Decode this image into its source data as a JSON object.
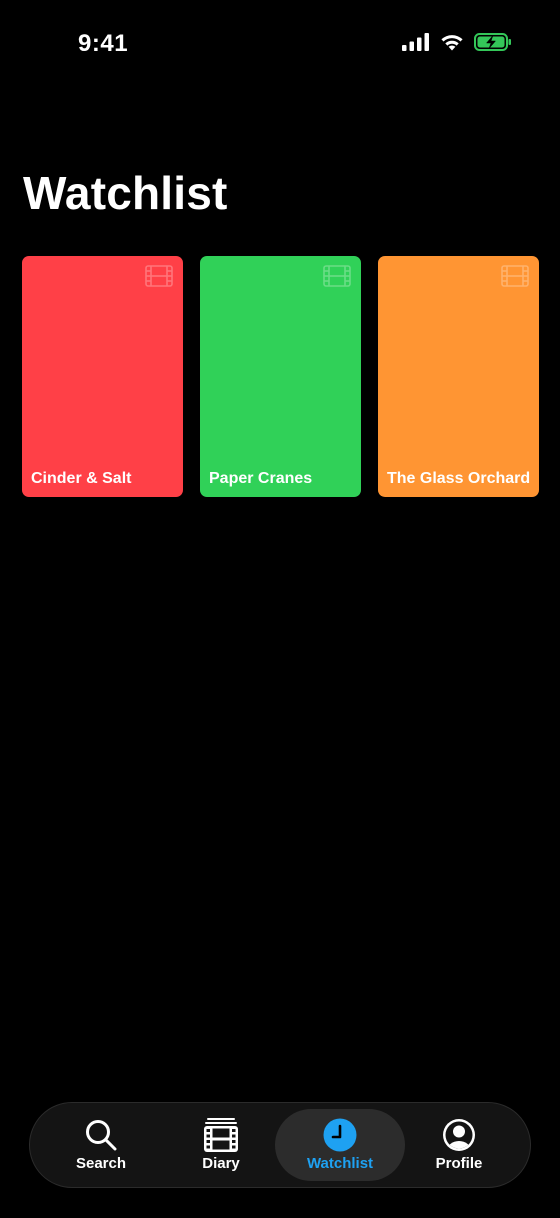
{
  "status_bar": {
    "time": "9:41",
    "icons": [
      "cellular-signal-icon",
      "wifi-icon",
      "battery-charging-icon"
    ],
    "battery_color": "#34c759"
  },
  "page": {
    "title": "Watchlist"
  },
  "watchlist": [
    {
      "title": "Cinder & Salt",
      "color": "#ff4047",
      "icon": "film-icon"
    },
    {
      "title": "Paper Cranes",
      "color": "#30d158",
      "icon": "film-icon"
    },
    {
      "title": "The Glass Orchard",
      "color": "#ff9533",
      "icon": "film-icon"
    }
  ],
  "tab_bar": {
    "active": "Watchlist",
    "accent_color": "#1ea1f2",
    "tabs": [
      {
        "label": "Search",
        "icon": "search-icon"
      },
      {
        "label": "Diary",
        "icon": "film-icon"
      },
      {
        "label": "Watchlist",
        "icon": "clock-icon"
      },
      {
        "label": "Profile",
        "icon": "person-circle-icon"
      }
    ]
  }
}
